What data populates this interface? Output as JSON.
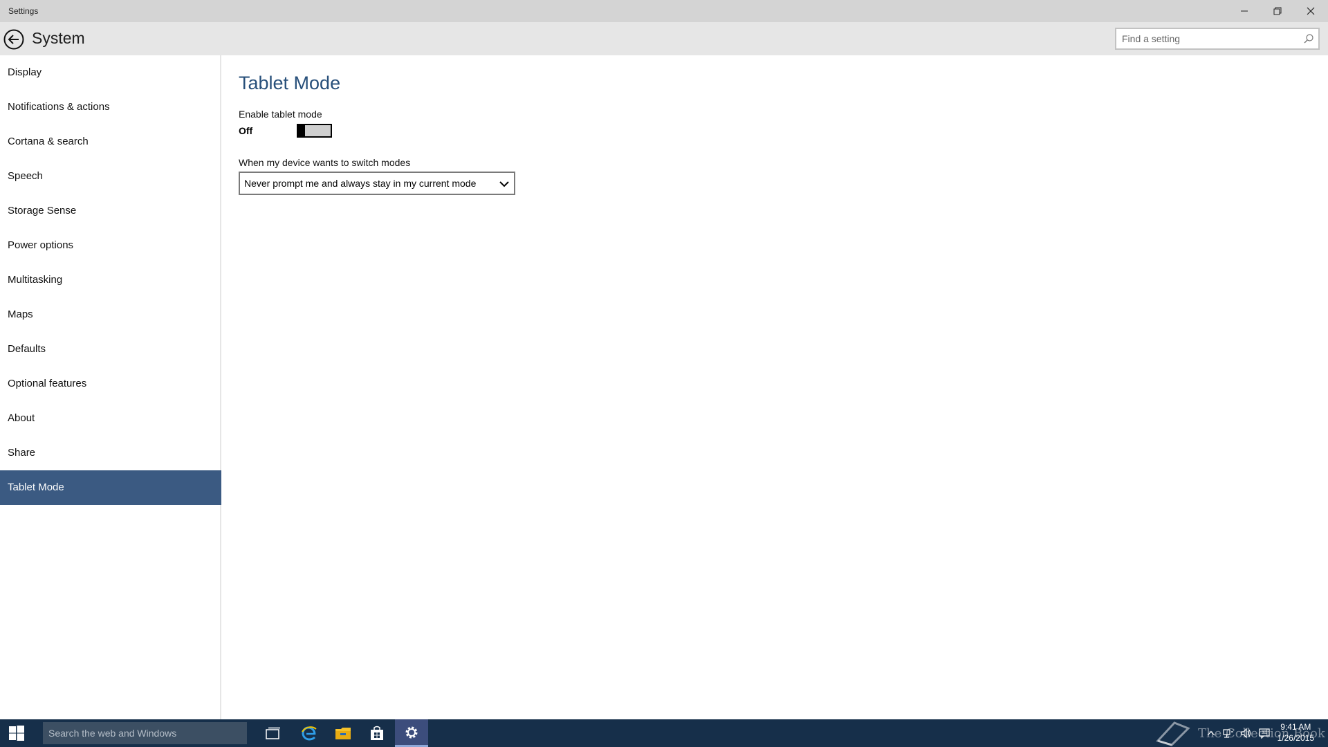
{
  "window": {
    "title": "Settings",
    "controls": {
      "minimize": "minimize-icon",
      "maximize": "restore-icon",
      "close": "close-icon"
    }
  },
  "header": {
    "section": "System",
    "back_icon": "back-arrow-icon",
    "search": {
      "placeholder": "Find a setting",
      "icon": "search-icon"
    }
  },
  "sidebar": {
    "items": [
      {
        "label": "Display"
      },
      {
        "label": "Notifications & actions"
      },
      {
        "label": "Cortana & search"
      },
      {
        "label": "Speech"
      },
      {
        "label": "Storage Sense"
      },
      {
        "label": "Power options"
      },
      {
        "label": "Multitasking"
      },
      {
        "label": "Maps"
      },
      {
        "label": "Defaults"
      },
      {
        "label": "Optional features"
      },
      {
        "label": "About"
      },
      {
        "label": "Share"
      },
      {
        "label": "Tablet Mode",
        "selected": true
      }
    ]
  },
  "main": {
    "title": "Tablet Mode",
    "tablet_mode": {
      "label": "Enable tablet mode",
      "state": "Off"
    },
    "switch_modes": {
      "label": "When my device wants to switch modes",
      "selected": "Never prompt me and always stay in my current mode"
    }
  },
  "taskbar": {
    "search_placeholder": "Search the web and Windows",
    "apps": [
      "task-view-icon",
      "edge-icon",
      "file-explorer-icon",
      "store-icon",
      "settings-icon"
    ],
    "active_app": "settings-icon",
    "watermark": "The Collection Book",
    "clock": {
      "time": "9:41 AM",
      "date": "1/26/2015"
    }
  },
  "colors": {
    "accent": "#3b5a82",
    "title_text": "#274f7a",
    "taskbar": "#162f4a"
  }
}
